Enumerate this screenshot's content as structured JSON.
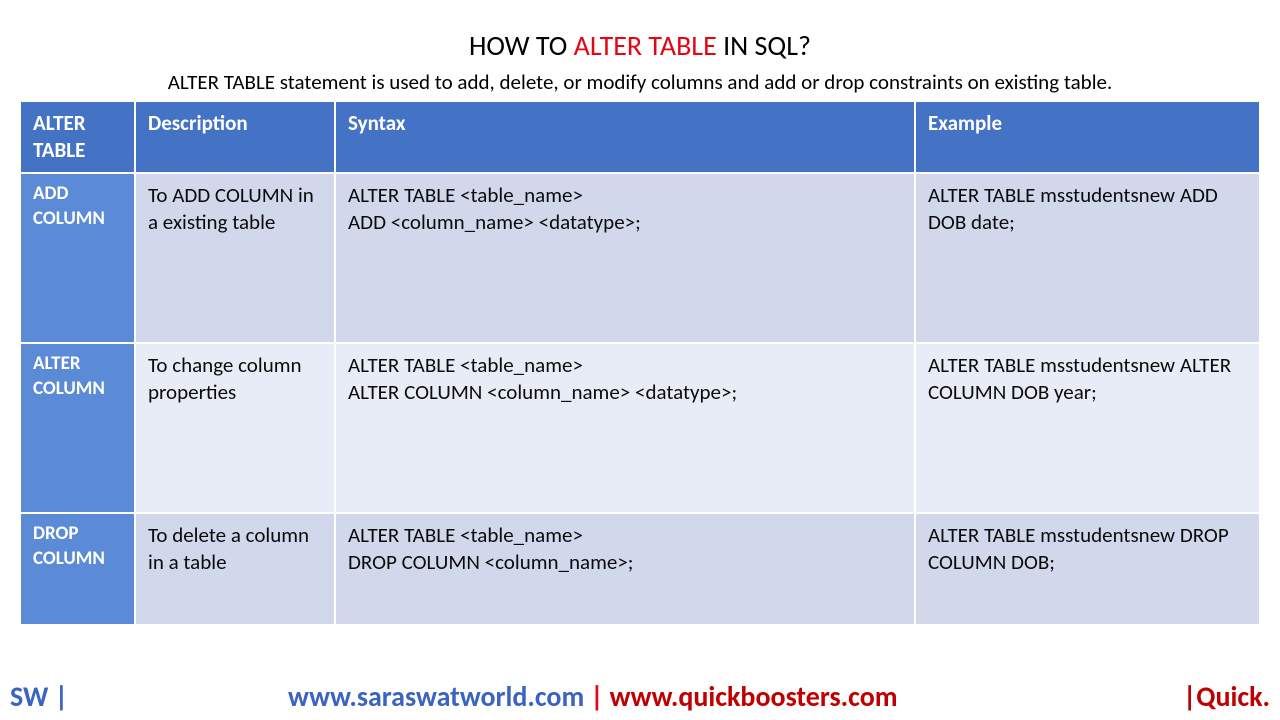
{
  "title": {
    "pre": "HOW TO ",
    "hl": "ALTER TABLE",
    "post": " IN SQL?"
  },
  "subtitle": "ALTER TABLE statement is used to add, delete, or modify columns and add or drop constraints on existing table.",
  "headers": {
    "c0": "ALTER TABLE",
    "c1": "Description",
    "c2": "Syntax",
    "c3": "Example"
  },
  "rows": [
    {
      "name": "ADD COLUMN",
      "desc": "To ADD COLUMN in a existing table",
      "syntax": "ALTER TABLE <table_name>\nADD <column_name> <datatype>;",
      "example": "ALTER TABLE msstudentsnew ADD DOB date;"
    },
    {
      "name": "ALTER COLUMN",
      "desc": "To change column properties",
      "syntax": "ALTER TABLE <table_name>\nALTER COLUMN <column_name> <datatype>;",
      "example": "ALTER TABLE msstudentsnew ALTER COLUMN DOB year;"
    },
    {
      "name": "DROP COLUMN",
      "desc": "To delete a column in a table",
      "syntax": "ALTER TABLE <table_name>\nDROP COLUMN <column_name>;",
      "example": "ALTER TABLE msstudentsnew DROP COLUMN DOB;"
    }
  ],
  "footer": {
    "sw": "SW |",
    "url1": "www.saraswatworld.com",
    "sep": "|",
    "url2": "www.quickboosters.com",
    "right": "|Quick."
  }
}
